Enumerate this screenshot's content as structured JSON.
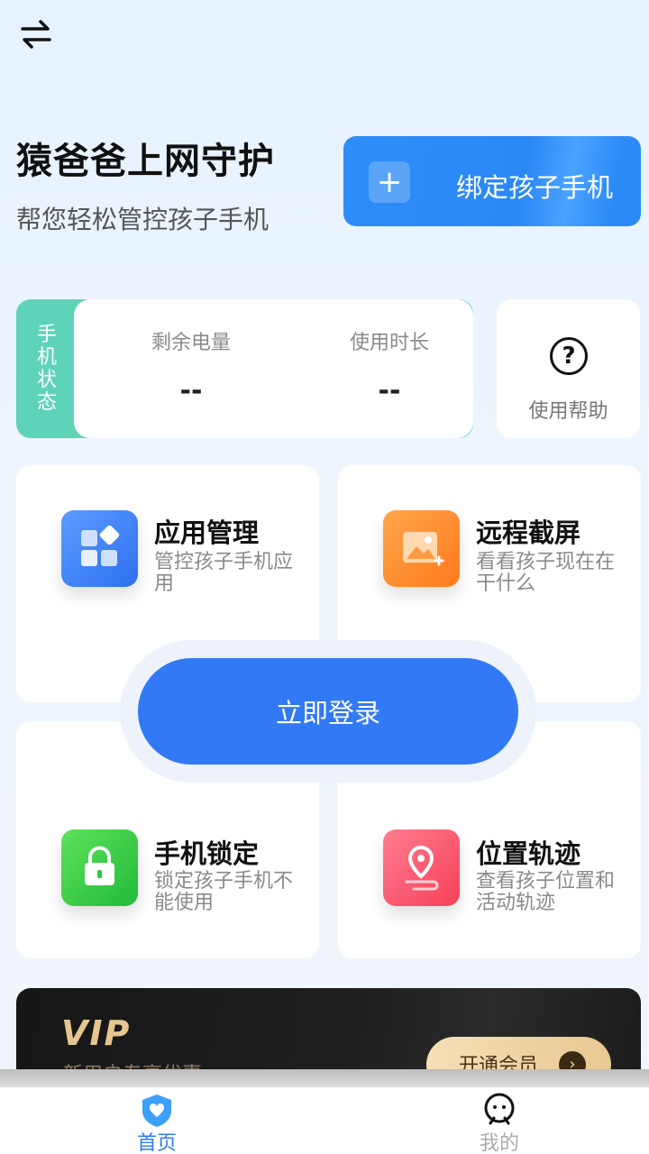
{
  "header": {
    "title": "猿爸爸上网守护",
    "subtitle": "帮您轻松管控孩子手机",
    "bind_button": "绑定孩子手机"
  },
  "status": {
    "tag": [
      "手",
      "机",
      "状",
      "态"
    ],
    "battery_label": "剩余电量",
    "battery_value": "--",
    "usage_label": "使用时长",
    "usage_value": "--",
    "help_label": "使用帮助"
  },
  "features": [
    {
      "name": "应用管理",
      "desc": "管控孩子手机应用",
      "color": "#3d82f7"
    },
    {
      "name": "远程截屏",
      "desc": "看看孩子现在在干什么",
      "color": "#ff8a2b"
    },
    {
      "name": "手机锁定",
      "desc": "锁定孩子手机不能使用",
      "color": "#2fc842"
    },
    {
      "name": "位置轨迹",
      "desc": "查看孩子位置和活动轨迹",
      "color": "#f7526a"
    }
  ],
  "login_button": "立即登录",
  "vip": {
    "logo": "VIP",
    "subtitle": "新用户专享优惠",
    "button": "开通会员"
  },
  "tabbar": {
    "home": "首页",
    "me": "我的"
  },
  "colors": {
    "accent": "#3279f5",
    "status_tag": "#5fd3b8"
  }
}
